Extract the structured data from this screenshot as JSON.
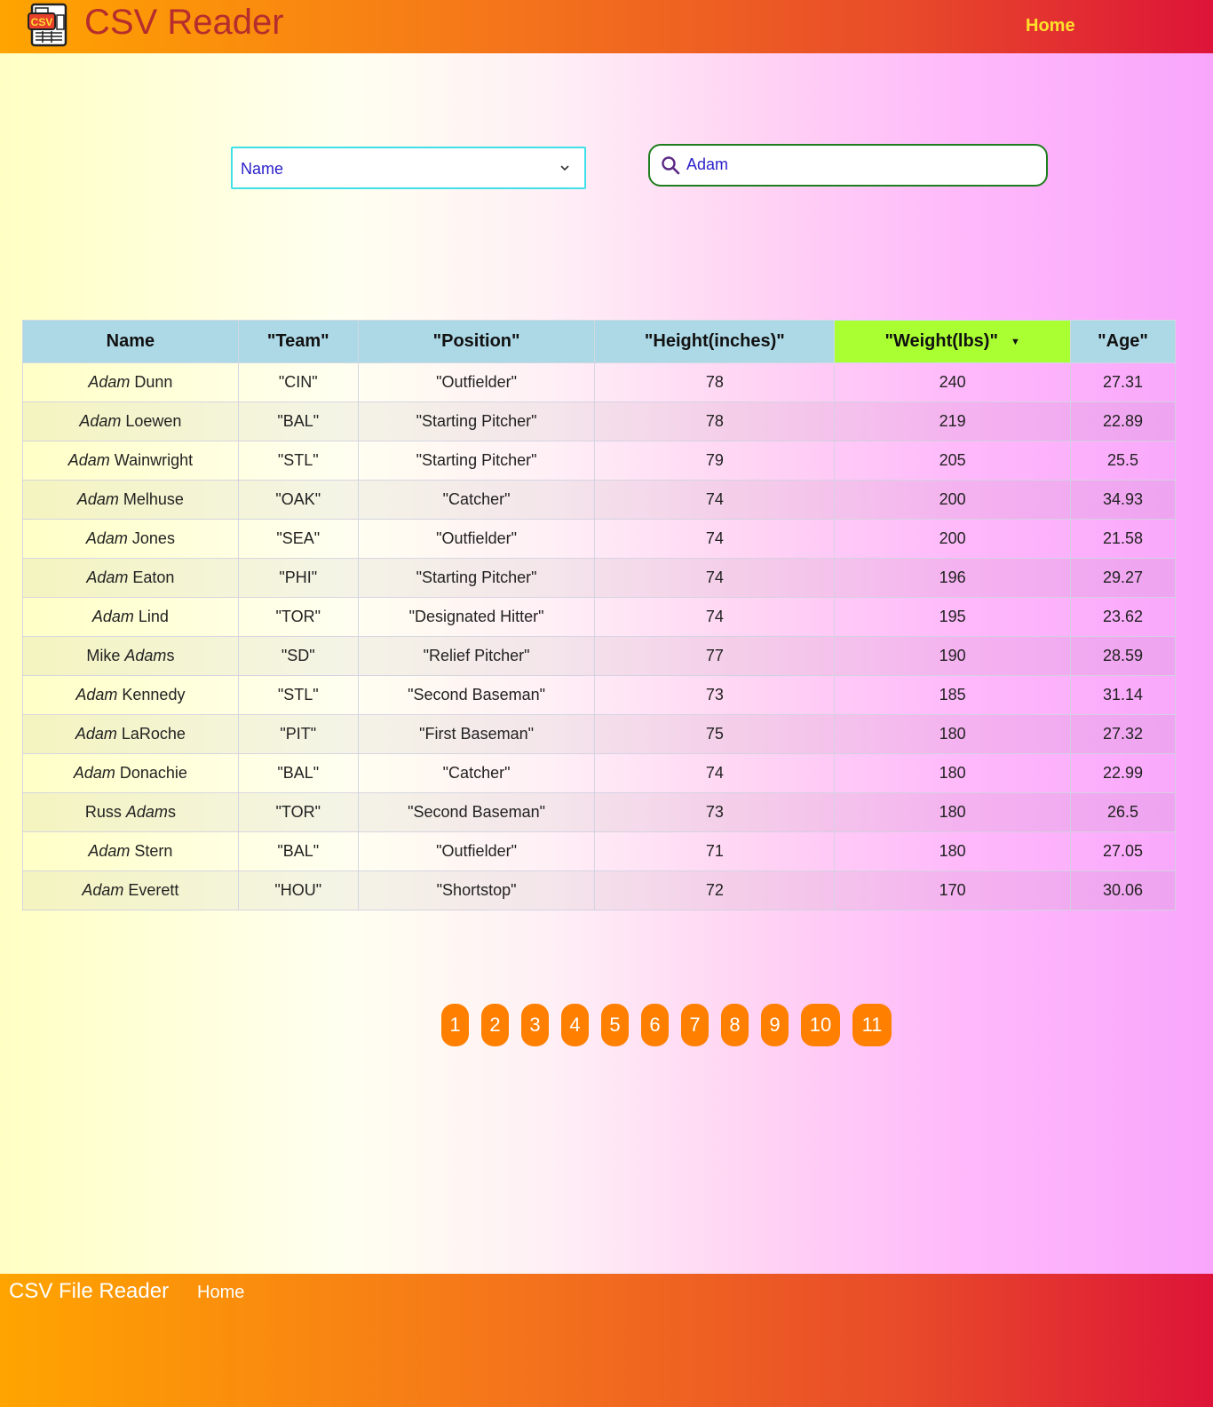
{
  "header": {
    "title": "CSV Reader",
    "home_link": "Home",
    "logo_text": "CSV"
  },
  "controls": {
    "column_select": {
      "selected": "Name"
    },
    "search": {
      "value": "Adam"
    }
  },
  "table": {
    "columns": [
      "Name",
      "\"Team\"",
      "\"Position\"",
      "\"Height(inches)\"",
      "\"Weight(lbs)\"",
      "\"Age\""
    ],
    "sorted_column": "\"Weight(lbs)\"",
    "sort_indicator": "▼",
    "rows": [
      {
        "name_pre": "",
        "name_em": "Adam",
        "name_post": " Dunn",
        "team": "\"CIN\"",
        "position": "\"Outfielder\"",
        "height": "78",
        "weight": "240",
        "age": "27.31"
      },
      {
        "name_pre": "",
        "name_em": "Adam",
        "name_post": " Loewen",
        "team": "\"BAL\"",
        "position": "\"Starting Pitcher\"",
        "height": "78",
        "weight": "219",
        "age": "22.89"
      },
      {
        "name_pre": "",
        "name_em": "Adam",
        "name_post": " Wainwright",
        "team": "\"STL\"",
        "position": "\"Starting Pitcher\"",
        "height": "79",
        "weight": "205",
        "age": "25.5"
      },
      {
        "name_pre": "",
        "name_em": "Adam",
        "name_post": " Melhuse",
        "team": "\"OAK\"",
        "position": "\"Catcher\"",
        "height": "74",
        "weight": "200",
        "age": "34.93"
      },
      {
        "name_pre": "",
        "name_em": "Adam",
        "name_post": " Jones",
        "team": "\"SEA\"",
        "position": "\"Outfielder\"",
        "height": "74",
        "weight": "200",
        "age": "21.58"
      },
      {
        "name_pre": "",
        "name_em": "Adam",
        "name_post": " Eaton",
        "team": "\"PHI\"",
        "position": "\"Starting Pitcher\"",
        "height": "74",
        "weight": "196",
        "age": "29.27"
      },
      {
        "name_pre": "",
        "name_em": "Adam",
        "name_post": " Lind",
        "team": "\"TOR\"",
        "position": "\"Designated Hitter\"",
        "height": "74",
        "weight": "195",
        "age": "23.62"
      },
      {
        "name_pre": "Mike ",
        "name_em": "Adam",
        "name_post": "s",
        "team": "\"SD\"",
        "position": "\"Relief Pitcher\"",
        "height": "77",
        "weight": "190",
        "age": "28.59"
      },
      {
        "name_pre": "",
        "name_em": "Adam",
        "name_post": " Kennedy",
        "team": "\"STL\"",
        "position": "\"Second Baseman\"",
        "height": "73",
        "weight": "185",
        "age": "31.14"
      },
      {
        "name_pre": "",
        "name_em": "Adam",
        "name_post": " LaRoche",
        "team": "\"PIT\"",
        "position": "\"First Baseman\"",
        "height": "75",
        "weight": "180",
        "age": "27.32"
      },
      {
        "name_pre": "",
        "name_em": "Adam",
        "name_post": " Donachie",
        "team": "\"BAL\"",
        "position": "\"Catcher\"",
        "height": "74",
        "weight": "180",
        "age": "22.99"
      },
      {
        "name_pre": "Russ ",
        "name_em": "Adam",
        "name_post": "s",
        "team": "\"TOR\"",
        "position": "\"Second Baseman\"",
        "height": "73",
        "weight": "180",
        "age": "26.5"
      },
      {
        "name_pre": "",
        "name_em": "Adam",
        "name_post": " Stern",
        "team": "\"BAL\"",
        "position": "\"Outfielder\"",
        "height": "71",
        "weight": "180",
        "age": "27.05"
      },
      {
        "name_pre": "",
        "name_em": "Adam",
        "name_post": " Everett",
        "team": "\"HOU\"",
        "position": "\"Shortstop\"",
        "height": "72",
        "weight": "170",
        "age": "30.06"
      }
    ]
  },
  "pagination": {
    "pages": [
      "1",
      "2",
      "3",
      "4",
      "5",
      "6",
      "7",
      "8",
      "9",
      "10",
      "11"
    ]
  },
  "footer": {
    "title": "CSV File Reader",
    "home_link": "Home"
  },
  "colors": {
    "header_start": "#ffa400",
    "header_end": "#dd1438",
    "accent_orange": "#ff7f00",
    "sorted_header": "#aaff33",
    "table_header": "#add8e6",
    "link_yellow": "#ffe02a"
  },
  "icons": {
    "logo": "csv-file-icon",
    "search": "search-icon",
    "select": "chevron-down-icon",
    "sort": "sort-desc-icon"
  }
}
